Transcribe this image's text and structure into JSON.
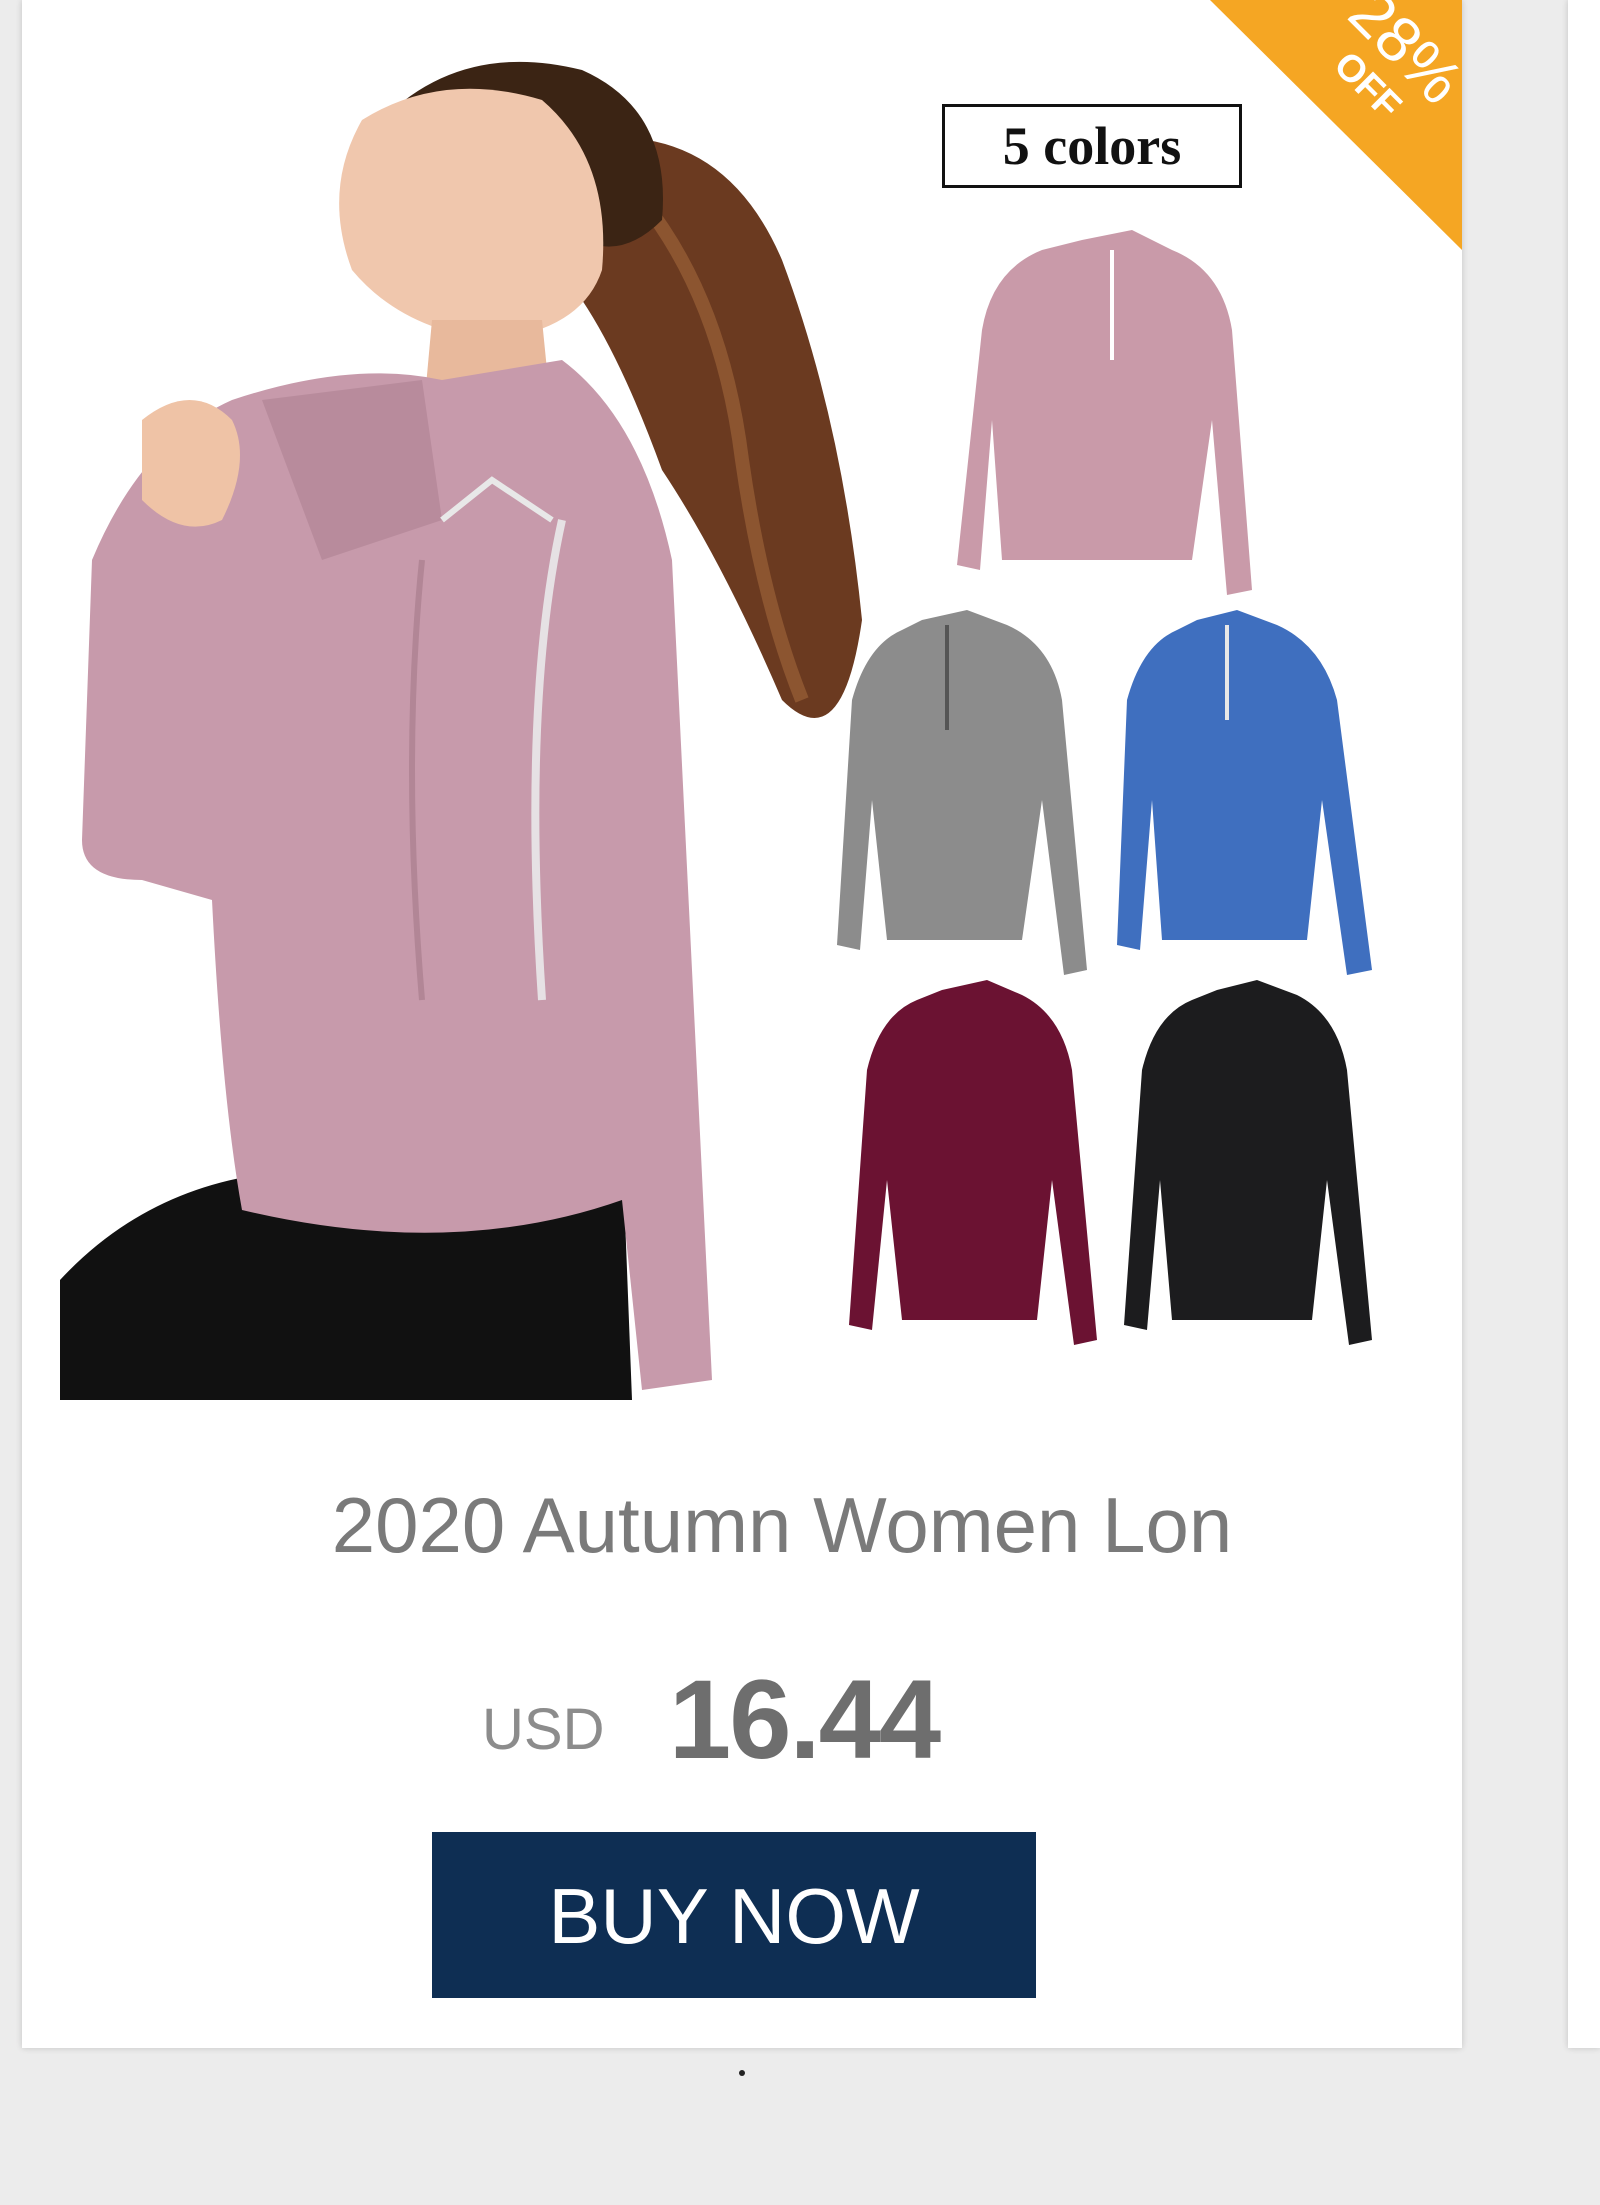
{
  "badge": {
    "percent": "28%",
    "off": "OFF",
    "color": "#f5a623"
  },
  "image": {
    "colors_label": "5 colors",
    "swatches": [
      "pink",
      "gray",
      "blue",
      "burgundy",
      "black"
    ],
    "swatch_colors": [
      "#c99aa9",
      "#8c8c8c",
      "#3f6fbf",
      "#6b1232",
      "#1c1c1e"
    ]
  },
  "product": {
    "title": "2020 Autumn Women Lon",
    "currency": "USD",
    "price": "16.44"
  },
  "cta": {
    "label": "BUY NOW",
    "color": "#0e2e53"
  },
  "pagination": {
    "icon": "dot-indicator"
  }
}
